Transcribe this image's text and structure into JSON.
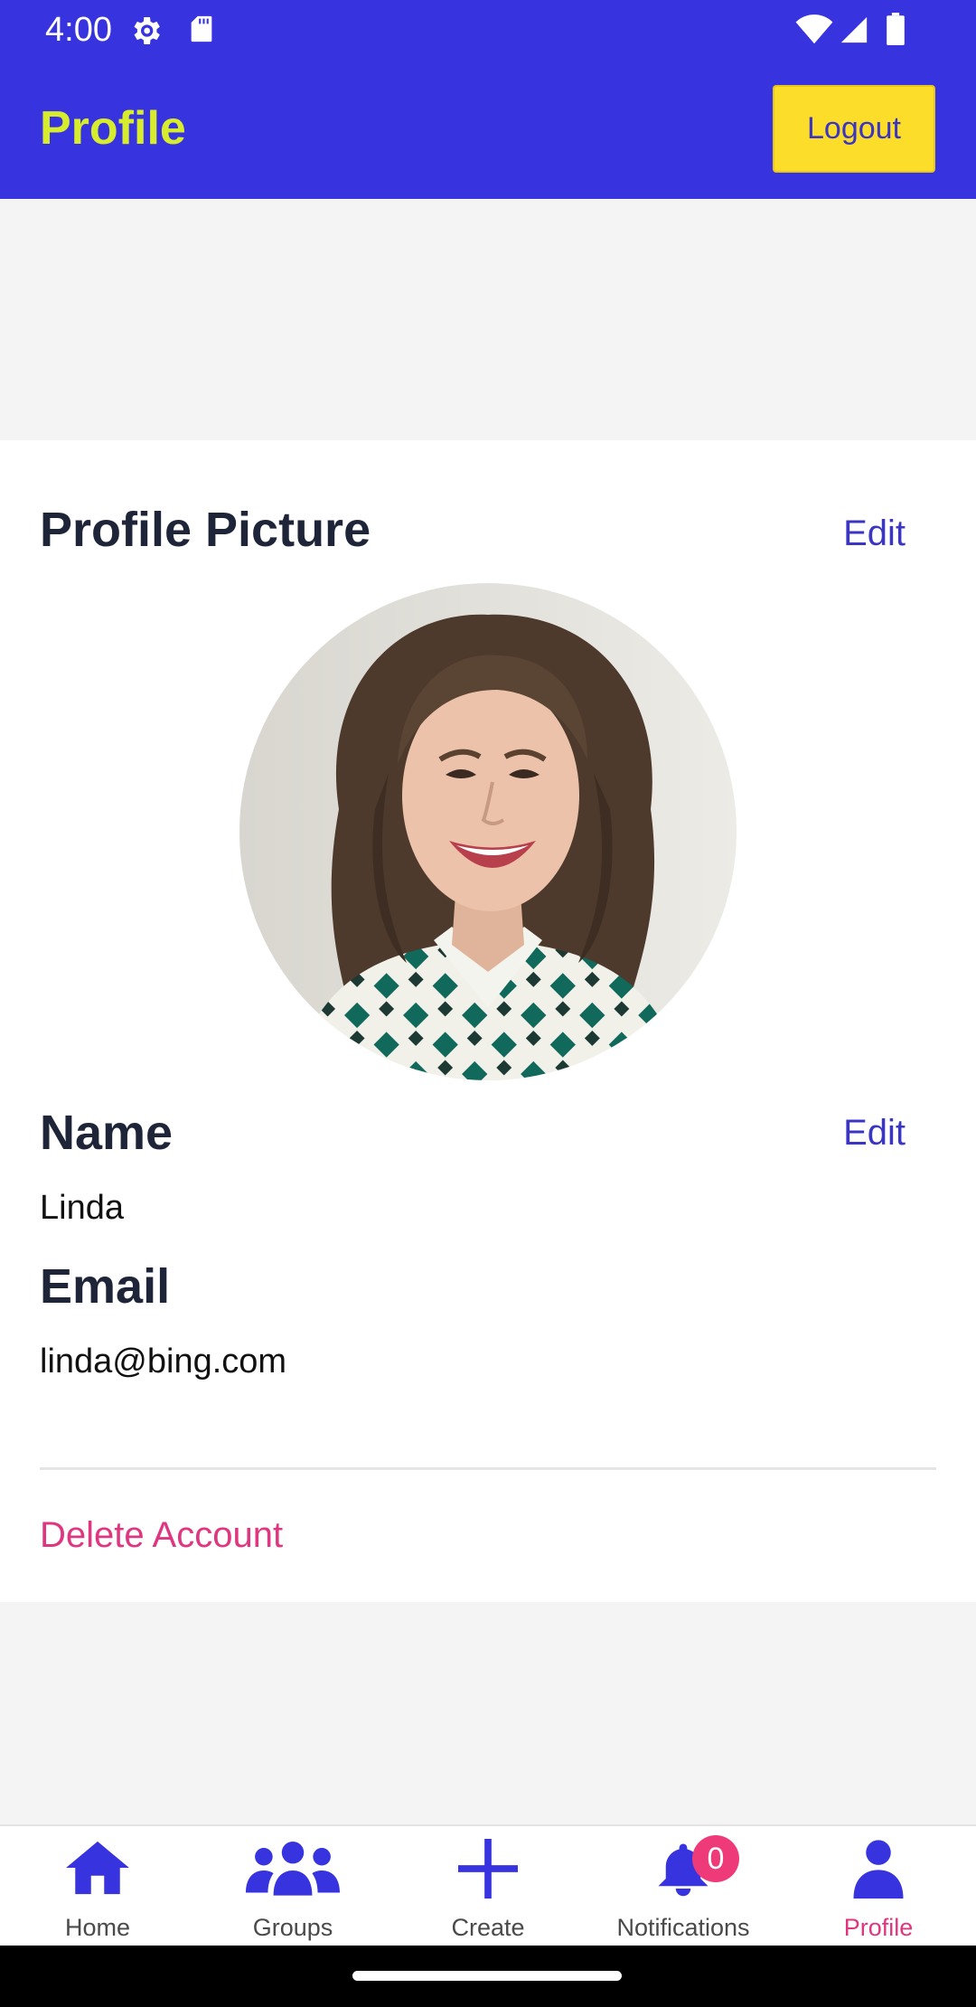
{
  "status_bar": {
    "time": "4:00",
    "icons": [
      "settings-gear-icon",
      "sd-card-icon",
      "wifi-icon",
      "cell-signal-icon",
      "battery-icon"
    ]
  },
  "header": {
    "title": "Profile",
    "logout_label": "Logout",
    "colors": {
      "bar": "#3633df",
      "title": "#d7ec2c",
      "logout_bg": "#fcdd2a"
    }
  },
  "profile": {
    "picture_title": "Profile Picture",
    "picture_edit": "Edit",
    "name_title": "Name",
    "name_edit": "Edit",
    "name_value": "Linda",
    "email_title": "Email",
    "email_value": "linda@bing.com",
    "delete_label": "Delete Account"
  },
  "bottom_nav": {
    "items": [
      {
        "label": "Home",
        "icon": "home-icon"
      },
      {
        "label": "Groups",
        "icon": "groups-icon"
      },
      {
        "label": "Create",
        "icon": "plus-icon"
      },
      {
        "label": "Notifications",
        "icon": "bell-icon",
        "badge": "0"
      },
      {
        "label": "Profile",
        "icon": "person-icon",
        "active": true
      }
    ],
    "colors": {
      "icon": "#3633df",
      "active_label": "#e0367f",
      "badge": "#ef3a7a"
    }
  }
}
